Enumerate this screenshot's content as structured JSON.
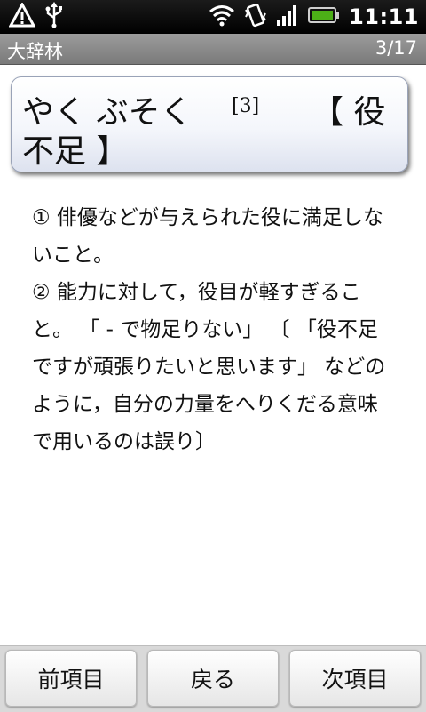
{
  "status_bar": {
    "time": "11:11",
    "icons": [
      "warning-icon",
      "usb-icon",
      "wifi-icon",
      "vibrate-icon",
      "signal-icon",
      "battery-icon"
    ],
    "battery_color": "#4caf17"
  },
  "title_bar": {
    "app_title": "大辞林",
    "page_counter": "3/17"
  },
  "headword": {
    "reading": "やく ぶそく",
    "number": "[3]",
    "kanji_line1": "【 役",
    "kanji_line2": "不足 】"
  },
  "definition": {
    "lines": [
      "① 俳優などが与えられた役に満足しな",
      "いこと。",
      "② 能力に対して，役目が軽すぎるこ",
      "と。 「 - で物足りない」 〔 「役不足",
      "ですが頑張りたいと思います」 などの",
      "ように，自分の力量をへりくだる意味",
      "で用いるのは誤り〕"
    ]
  },
  "bottom_bar": {
    "prev_label": "前項目",
    "back_label": "戻る",
    "next_label": "次項目"
  }
}
